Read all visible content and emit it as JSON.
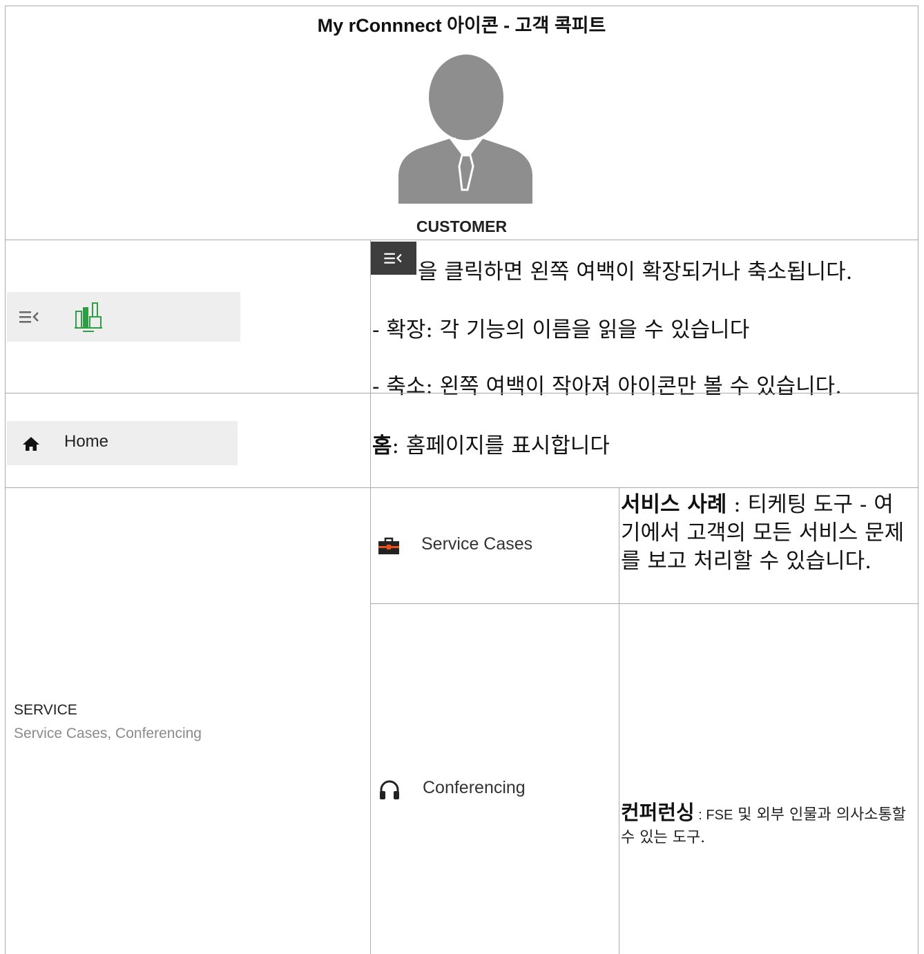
{
  "header": {
    "title": "My rConnnect 아이콘 - 고객 콕피트",
    "avatar_label": "CUSTOMER"
  },
  "menu_row": {
    "line1": "을 클릭하면 왼쪽 여백이 확장되거나 축소됩니다.",
    "line2": "- 확장: 각 기능의 이름을 읽을 수 있습니다",
    "line3": "- 축소: 왼쪽 여백이 작아져 아이콘만 볼 수 있습니다."
  },
  "home_row": {
    "nav_label": "Home",
    "desc_bold": "홈",
    "desc_rest": ": 홈페이지를 표시합니다"
  },
  "service_row": {
    "section_title": "SERVICE",
    "section_subtitle": "Service Cases, Conferencing",
    "service_cases": {
      "nav_label": "Service Cases",
      "desc_bold": "서비스 사례",
      "desc_rest": " : 티케팅 도구 - 여기에서 고객의 모든 서비스 문제를 보고 처리할 수 있습니다."
    },
    "conferencing": {
      "nav_label": "Conferencing",
      "desc_bold": "컨퍼런싱",
      "desc_sep": " : ",
      "desc_fse": "FSE",
      "desc_rest": " 및 외부 인물과 의사소통할 수 있는 도구."
    }
  },
  "colors": {
    "grid_border": "#aaaaaa",
    "nav_bg": "#eeeeee",
    "icon_dark": "#3d3d3d",
    "factory_green": "#2e9e44",
    "briefcase_orange": "#e8531a"
  },
  "icons": [
    "person-avatar-icon",
    "menu-collapse-icon",
    "factory-icon",
    "home-icon",
    "briefcase-icon",
    "headset-icon"
  ]
}
